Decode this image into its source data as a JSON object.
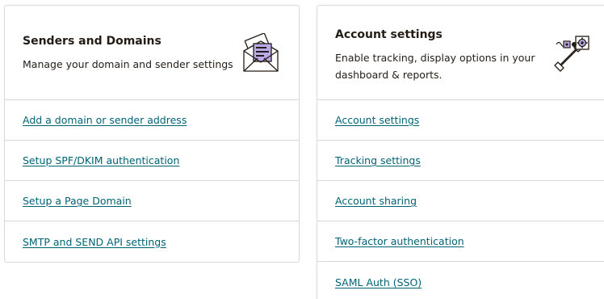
{
  "colors": {
    "link": "#006375",
    "border": "#d8d8d8",
    "text": "#241c15",
    "accent_purple": "#b9a9e8"
  },
  "senders": {
    "title": "Senders and Domains",
    "description": "Manage your domain and sender settings",
    "icon": "envelope-illustration",
    "links": [
      "Add a domain or sender address",
      "Setup SPF/DKIM authentication",
      "Setup a Page Domain",
      "SMTP and SEND API settings"
    ]
  },
  "account": {
    "title": "Account settings",
    "description": "Enable tracking, display options in your dashboard & reports.",
    "icon": "wrench-gear-illustration",
    "links": [
      "Account settings",
      "Tracking settings",
      "Account sharing",
      "Two-factor authentication",
      "SAML Auth (SSO)"
    ]
  }
}
